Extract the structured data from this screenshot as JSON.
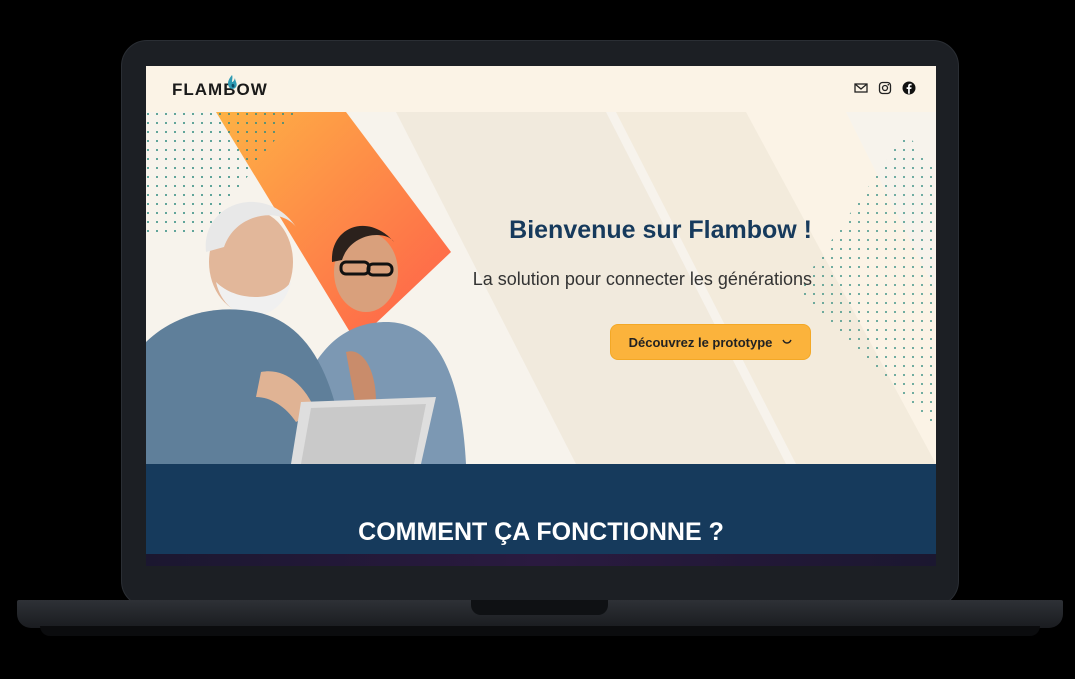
{
  "header": {
    "logo_text": "FLAMBOW",
    "icons": [
      "mail-icon",
      "instagram-icon",
      "facebook-icon"
    ]
  },
  "hero": {
    "title": "Bienvenue sur Flambow !",
    "subtitle": "La solution pour connecter les générations",
    "cta_label": "Découvrez le prototype"
  },
  "section": {
    "title": "COMMENT ÇA FONCTIONNE ?"
  },
  "colors": {
    "navy": "#163a5c",
    "accent_yellow": "#fbb33c",
    "accent_orange": "#ff7a45",
    "background_cream": "#fbf3e6",
    "dots_teal": "#2f8a7f"
  }
}
